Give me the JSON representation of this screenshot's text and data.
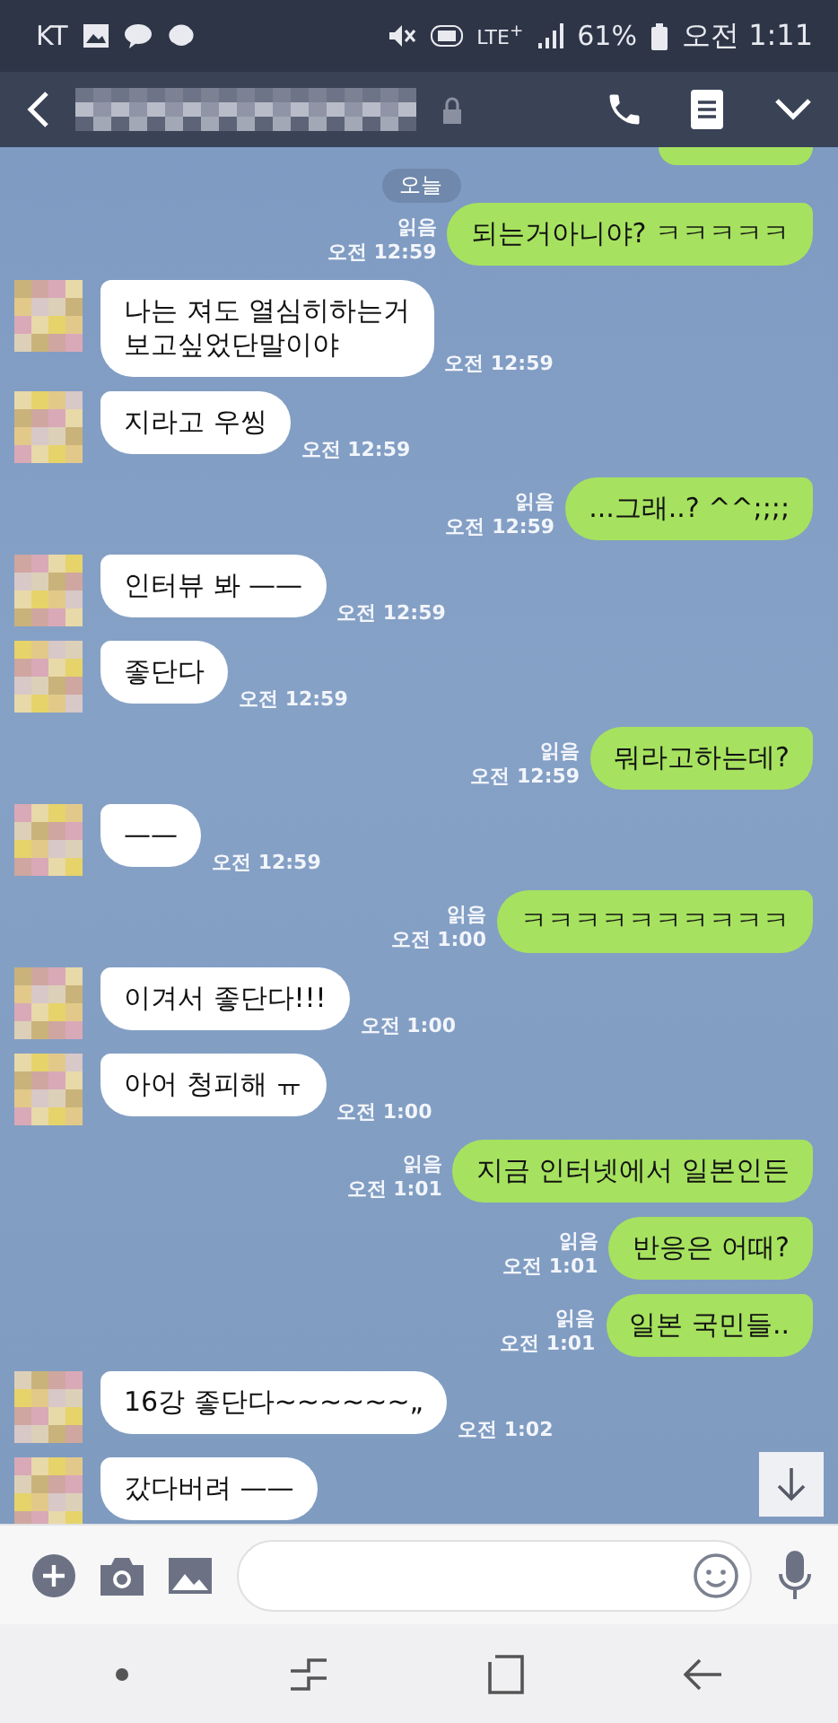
{
  "status_bar": {
    "carrier": "KT",
    "network": "LTE$^{+}$",
    "battery": "61%",
    "time": "오전 1:11"
  },
  "messages": [
    {
      "kind": "date",
      "text": "오늘"
    },
    {
      "kind": "sent",
      "text": "되는거아니야? ㅋㅋㅋㅋㅋ",
      "read": "읽음",
      "time": "오전 12:59"
    },
    {
      "kind": "received",
      "text": "나는 져도 열심히하는거\n보고싶었단말이야",
      "time": "오전 12:59"
    },
    {
      "kind": "received",
      "text": "지라고 우씽",
      "time": "오전 12:59"
    },
    {
      "kind": "sent",
      "text": "...그래..? ^^;;;;",
      "read": "읽음",
      "time": "오전 12:59"
    },
    {
      "kind": "received",
      "text": "인터뷰 봐 ——",
      "time": "오전 12:59"
    },
    {
      "kind": "received",
      "text": "좋단다",
      "time": "오전 12:59"
    },
    {
      "kind": "sent",
      "text": "뭐라고하는데?",
      "read": "읽음",
      "time": "오전 12:59"
    },
    {
      "kind": "received",
      "text": "——",
      "time": "오전 12:59"
    },
    {
      "kind": "sent",
      "text": "ㅋㅋㅋㅋㅋㅋㅋㅋㅋㅋ",
      "read": "읽음",
      "time": "오전 1:00"
    },
    {
      "kind": "received",
      "text": "이겨서 좋단다!!!",
      "time": "오전 1:00"
    },
    {
      "kind": "received",
      "text": "아어 청피해 ㅠ",
      "time": "오전 1:00"
    },
    {
      "kind": "sent",
      "text": "지금 인터넷에서 일본인든",
      "read": "읽음",
      "time": "오전 1:01"
    },
    {
      "kind": "sent",
      "text": "반응은 어때?",
      "read": "읽음",
      "time": "오전 1:01"
    },
    {
      "kind": "sent",
      "text": "일본 국민들..",
      "read": "읽음",
      "time": "오전 1:01"
    },
    {
      "kind": "received",
      "text": "16강 좋단다~~~~~~„",
      "time": "오전 1:02"
    },
    {
      "kind": "received",
      "text": "갔다버려 ——"
    }
  ]
}
